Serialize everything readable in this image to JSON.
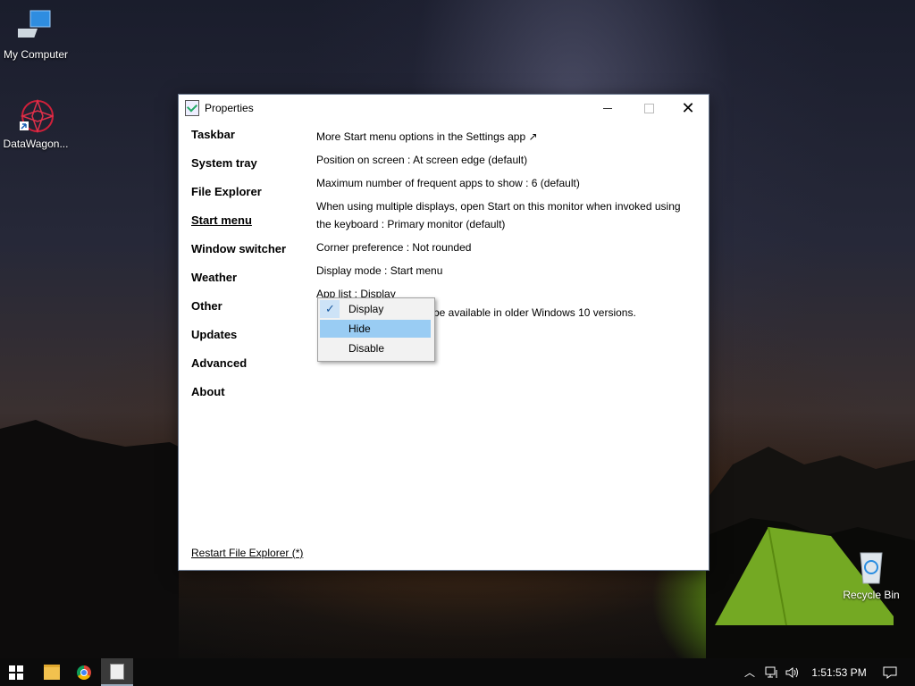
{
  "desktop": {
    "icons": [
      {
        "label": "My Computer",
        "icon": "computer-icon"
      },
      {
        "label": "DataWagon...",
        "icon": "datawagon-icon"
      },
      {
        "label": "Recycle Bin",
        "icon": "recycle-bin-icon"
      }
    ]
  },
  "window": {
    "title": "Properties",
    "nav": [
      {
        "label": "Taskbar"
      },
      {
        "label": "System tray"
      },
      {
        "label": "File Explorer"
      },
      {
        "label": "Start menu",
        "active": true
      },
      {
        "label": "Window switcher"
      },
      {
        "label": "Weather"
      },
      {
        "label": "Other"
      },
      {
        "label": "Updates"
      },
      {
        "label": "Advanced"
      },
      {
        "label": "About"
      }
    ],
    "restart_link": "Restart File Explorer (*)",
    "settings": [
      "More Start menu options in the Settings app ↗",
      "Position on screen : At screen edge (default)",
      "Maximum number of frequent apps to show : 6 (default)",
      "When using multiple displays, open Start on this monitor when invoked using the keyboard : Primary monitor (default)",
      "Corner preference : Not rounded",
      "Display mode : Start menu",
      "App list : Display"
    ],
    "note_partial": "be available in older Windows 10 versions."
  },
  "context_menu": {
    "items": [
      {
        "label": "Display",
        "checked": true
      },
      {
        "label": "Hide",
        "highlighted": true
      },
      {
        "label": "Disable"
      }
    ]
  },
  "taskbar": {
    "clock": "1:51:53 PM"
  }
}
